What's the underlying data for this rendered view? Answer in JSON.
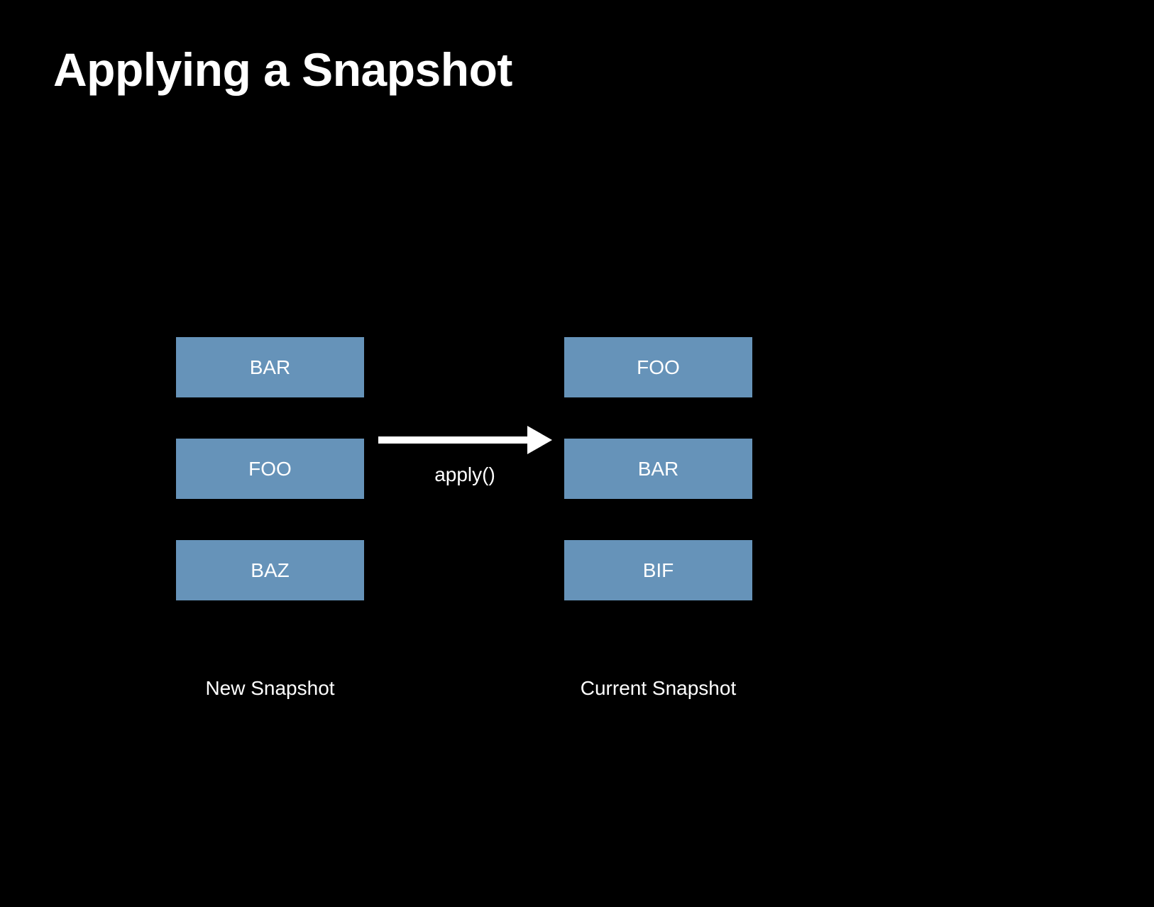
{
  "title": "Applying a Snapshot",
  "arrow_label": "apply()",
  "columns": {
    "left": {
      "label": "New Snapshot",
      "items": [
        "BAR",
        "FOO",
        "BAZ"
      ]
    },
    "right": {
      "label": "Current Snapshot",
      "items": [
        "FOO",
        "BAR",
        "BIF"
      ]
    }
  },
  "colors": {
    "background": "#000000",
    "box": "#6693b9",
    "text": "#ffffff"
  }
}
